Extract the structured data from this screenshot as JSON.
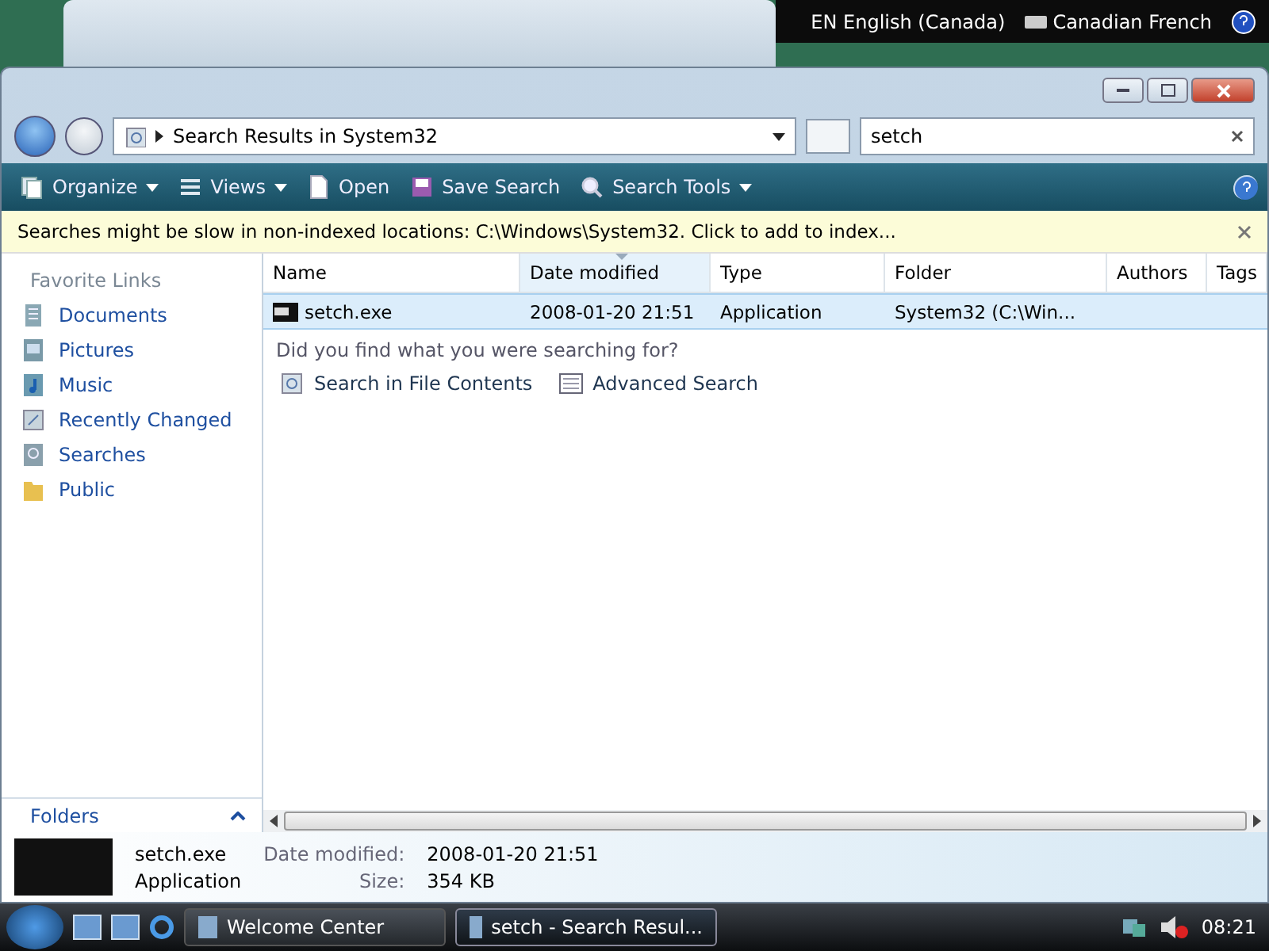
{
  "language_bar": {
    "items": [
      {
        "kind": "language",
        "label": "EN English (Canada)"
      },
      {
        "kind": "keyboard",
        "label": "Canadian French"
      }
    ]
  },
  "window": {
    "address": "Search Results in System32",
    "search": {
      "value": "setch"
    }
  },
  "toolbar": [
    {
      "label": "Organize",
      "kind": "organize",
      "dropdown": true
    },
    {
      "label": "Views",
      "kind": "views",
      "dropdown": true
    },
    {
      "label": "Open",
      "kind": "open",
      "dropdown": false
    },
    {
      "label": "Save Search",
      "kind": "save",
      "dropdown": false
    },
    {
      "label": "Search Tools",
      "kind": "tools",
      "dropdown": true
    }
  ],
  "info_bar": {
    "text": "Searches might be slow in non-indexed locations: C:\\Windows\\System32. Click to add to index..."
  },
  "sidebar": {
    "header": "Favorite Links",
    "items": [
      {
        "label": "Documents",
        "kind": "documents"
      },
      {
        "label": "Pictures",
        "kind": "pictures"
      },
      {
        "label": "Music",
        "kind": "music"
      },
      {
        "label": "Recently Changed",
        "kind": "recent"
      },
      {
        "label": "Searches",
        "kind": "searches"
      },
      {
        "label": "Public",
        "kind": "folder"
      }
    ],
    "folders": "Folders"
  },
  "table": {
    "columns": [
      {
        "label": "Name",
        "sorted": false
      },
      {
        "label": "Date modified",
        "sorted": true
      },
      {
        "label": "Type",
        "sorted": false
      },
      {
        "label": "Folder",
        "sorted": false
      },
      {
        "label": "Authors",
        "sorted": false
      },
      {
        "label": "Tags",
        "sorted": false
      }
    ],
    "rows": [
      {
        "selected": true,
        "cells": [
          "setch.exe",
          "2008-01-20 21:51",
          "Application",
          "System32 (C:\\Win..."
        ]
      }
    ]
  },
  "search_prompt": {
    "text": "Did you find what you were searching for?",
    "links": [
      {
        "label": "Search in File Contents",
        "kind": "search-contents"
      },
      {
        "label": "Advanced Search",
        "kind": "advanced"
      }
    ]
  },
  "details": {
    "name": "setch.exe",
    "type": "Application",
    "fields": [
      {
        "label": "Date modified:",
        "value": "2008-01-20 21:51"
      },
      {
        "label": "Size:",
        "value": "354 KB"
      }
    ]
  },
  "taskbar": {
    "buttons": [
      {
        "label": "Welcome Center",
        "selected": false
      },
      {
        "label": "setch - Search Resul...",
        "selected": true
      }
    ],
    "clock": "08:21"
  }
}
